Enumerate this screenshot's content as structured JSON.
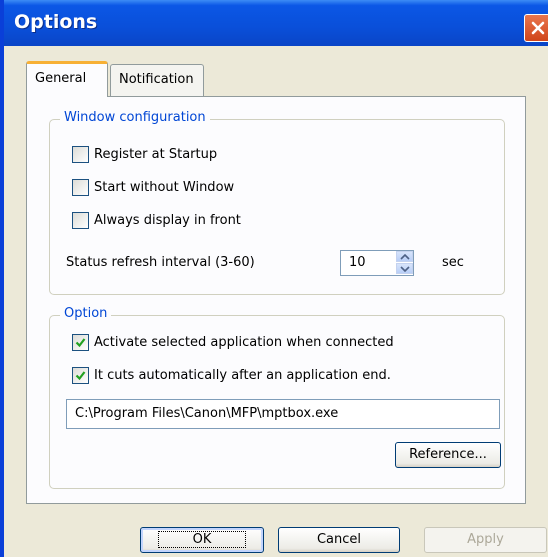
{
  "window": {
    "title": "Options"
  },
  "tabs": [
    {
      "label": "General",
      "active": true
    },
    {
      "label": "Notification",
      "active": false
    }
  ],
  "window_config": {
    "legend": "Window configuration",
    "checkboxes": [
      {
        "label": "Register at Startup",
        "checked": false
      },
      {
        "label": "Start without Window",
        "checked": false
      },
      {
        "label": "Always display in front",
        "checked": false
      }
    ],
    "refresh_label": "Status refresh interval (3-60)",
    "refresh_value": "10",
    "refresh_unit": "sec"
  },
  "option": {
    "legend": "Option",
    "checkboxes": [
      {
        "label": "Activate selected application when connected",
        "checked": true
      },
      {
        "label": "It cuts automatically after an application end.",
        "checked": true
      }
    ],
    "path_value": "C:\\Program Files\\Canon\\MFP\\mptbox.exe",
    "reference_label": "Reference..."
  },
  "buttons": {
    "ok": "OK",
    "cancel": "Cancel",
    "apply": "Apply"
  },
  "colors": {
    "titlebar": "#0a4fd9",
    "accent_tab": "#f7b035",
    "legend_text": "#0046d5",
    "check": "#21a121"
  },
  "icons": {
    "close": "close-icon",
    "check": "checkmark-icon",
    "spin_up": "arrow-up-icon",
    "spin_down": "arrow-down-icon"
  }
}
